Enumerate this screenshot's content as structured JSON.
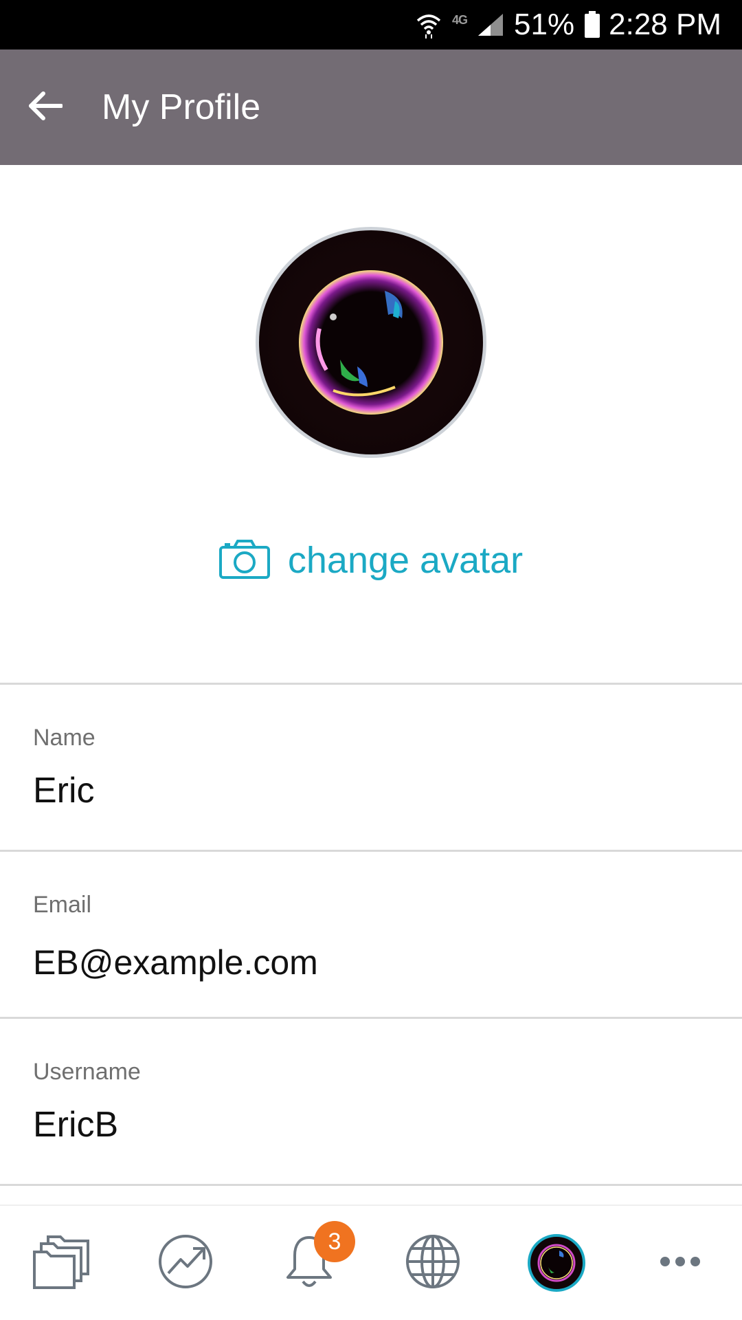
{
  "status_bar": {
    "network_label": "4G",
    "battery_percent": "51%",
    "time": "2:28 PM"
  },
  "header": {
    "title": "My Profile",
    "back_icon": "arrow-left-icon",
    "color": "#736c74"
  },
  "avatar": {
    "image": "soap-bubble-avatar",
    "change_label": "change avatar",
    "change_icon": "camera-icon",
    "accent": "#1ba9c4"
  },
  "fields": [
    {
      "label": "Name",
      "value": "Eric"
    },
    {
      "label": "Email",
      "value": "EB@example.com"
    },
    {
      "label": "Username",
      "value": "EricB"
    }
  ],
  "bottom_nav": {
    "items": [
      {
        "icon": "folders-icon"
      },
      {
        "icon": "trending-chart-icon"
      },
      {
        "icon": "bell-icon",
        "badge": "3"
      },
      {
        "icon": "globe-icon"
      },
      {
        "icon": "profile-avatar-icon"
      },
      {
        "icon": "more-dots-icon"
      }
    ],
    "badge_color": "#f07320"
  }
}
